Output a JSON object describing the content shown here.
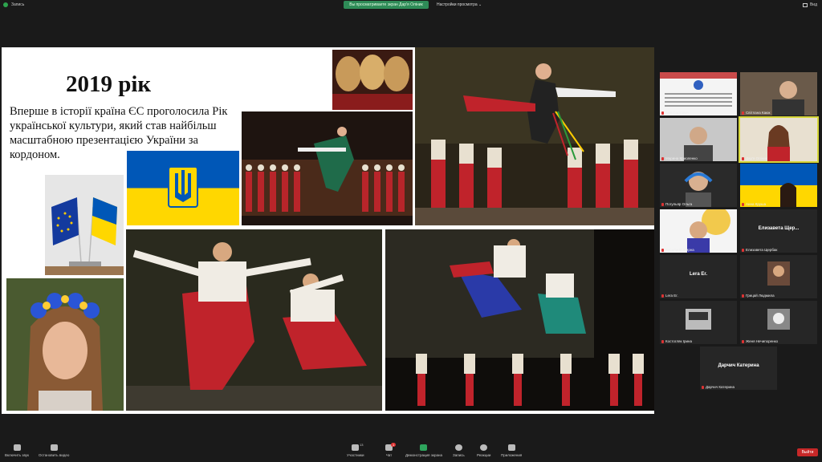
{
  "topbar": {
    "recording_label": "Запись",
    "share_banner": "Вы просматриваете экран Дар'я Оліник",
    "view_options": "Настройки просмотра ⌄",
    "view_mode": "Вид"
  },
  "slide": {
    "title": "2019 рік",
    "text": "Вперше в історії країна ЄС проголосила Рік української культури, який став найбільш масштабною презентацією України за кордоном."
  },
  "participants": [
    {
      "name": "Аня Салтович"
    },
    {
      "name": "Світлана Каюк"
    },
    {
      "name": "Марина Криоленко"
    },
    {
      "name": "Дар'я Оліник"
    },
    {
      "name": "Погульяр Ольга"
    },
    {
      "name": "Анна Круша"
    },
    {
      "name": "Василина Жирна"
    },
    {
      "name": "Елизавета Щербак",
      "display": "Елизавета Щер..."
    },
    {
      "name": "Lera Er.",
      "display": "Lera Er."
    },
    {
      "name": "Грицай Людмила"
    },
    {
      "name": "Костогляк Ірина"
    },
    {
      "name": "Женя Нечипоренко"
    },
    {
      "name": "Дарчич Катерина",
      "display": "Дарчич Катерина"
    }
  ],
  "toolbar": {
    "mute": "Включить звук",
    "video": "Остановить видео",
    "participants": "Участники",
    "participants_count": "13",
    "chat": "Чат",
    "chat_badge": "1",
    "share": "Демонстрация экрана",
    "record": "Запись",
    "reactions": "Реакции",
    "apps": "Приложения",
    "exit": "Выйти"
  },
  "colors": {
    "share_green": "#2e8b57",
    "exit_red": "#c62828",
    "ua_blue": "#0057b7",
    "ua_yellow": "#ffd700"
  }
}
